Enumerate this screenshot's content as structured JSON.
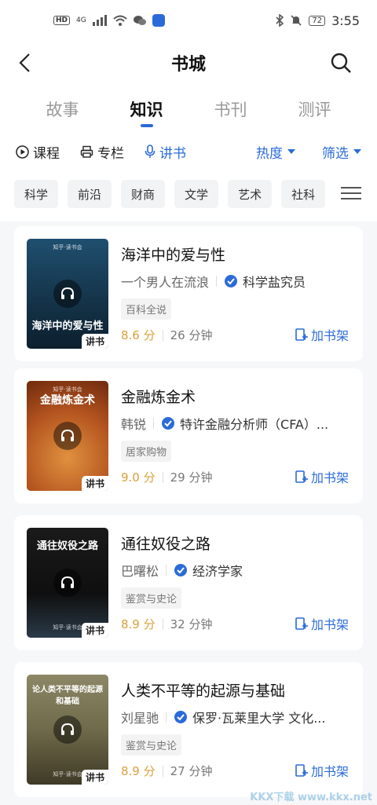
{
  "status_bar": {
    "hd": "HD",
    "net": "4G",
    "battery": "72",
    "time": "3:55"
  },
  "header": {
    "title": "书城"
  },
  "tabs": [
    {
      "label": "故事"
    },
    {
      "label": "知识",
      "active": true
    },
    {
      "label": "书刊"
    },
    {
      "label": "测评"
    }
  ],
  "subnav": {
    "items": [
      {
        "label": "课程",
        "icon": "play-circle-icon"
      },
      {
        "label": "专栏",
        "icon": "printer-icon"
      },
      {
        "label": "讲书",
        "icon": "microphone-icon",
        "active": true
      }
    ],
    "sort_label": "热度",
    "filter_label": "筛选"
  },
  "categories": [
    "科学",
    "前沿",
    "财商",
    "文学",
    "艺术",
    "社科"
  ],
  "books": [
    {
      "title": "海洋中的爱与性",
      "author": "一个男人在流浪",
      "role": "科学盐究员",
      "tag": "百科全说",
      "score": "8.6 分",
      "duration": "26 分钟",
      "add_label": "加书架",
      "badge": "讲书",
      "cover_title": "海洋中的爱与性",
      "cover_brand": "知乎·读书会",
      "cover_color": "#1d4564"
    },
    {
      "title": "金融炼金术",
      "author": "韩锐",
      "role": "特许金融分析师（CFA）...",
      "tag": "居家购物",
      "score": "9.0 分",
      "duration": "29 分钟",
      "add_label": "加书架",
      "badge": "讲书",
      "cover_title": "金融炼金术",
      "cover_brand": "知乎·读书会",
      "cover_color": "#b3531f"
    },
    {
      "title": "通往奴役之路",
      "author": "巴曙松",
      "role": "经济学家",
      "tag": "鉴赏与史论",
      "score": "8.9 分",
      "duration": "32 分钟",
      "add_label": "加书架",
      "badge": "讲书",
      "cover_title": "通往奴役之路",
      "cover_brand": "知乎·读书会",
      "cover_color": "#141414"
    },
    {
      "title": "人类不平等的起源与基础",
      "author": "刘星驰",
      "role": "保罗·瓦莱里大学 文化...",
      "tag": "鉴赏与史论",
      "score": "8.9 分",
      "duration": "27 分钟",
      "add_label": "加书架",
      "badge": "讲书",
      "cover_title": "论人类不平等的起源和基础",
      "cover_brand": "知乎·读书会",
      "cover_color": "#6f6a4a"
    }
  ],
  "watermark": "KKX下载 www.kkx.net",
  "colors": {
    "accent": "#2b6bd9",
    "score": "#d9a13a"
  }
}
